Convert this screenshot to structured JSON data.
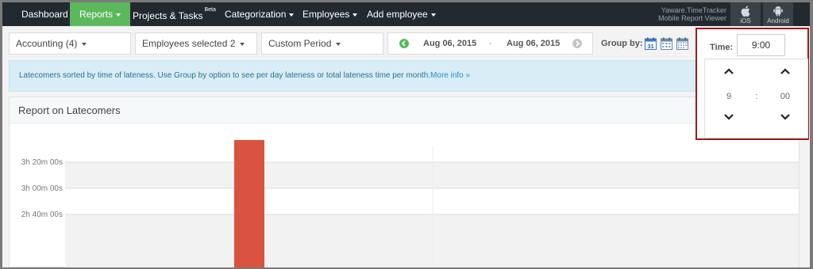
{
  "navbar": {
    "items": [
      {
        "label": "Dashboard",
        "dropdown": false
      },
      {
        "label": "Reports",
        "dropdown": true,
        "active": true
      },
      {
        "label": "Projects & Tasks",
        "badge": "Beta",
        "dropdown": false
      },
      {
        "label": "Categorization",
        "dropdown": true
      },
      {
        "label": "Employees",
        "dropdown": true
      },
      {
        "label": "Add employee",
        "dropdown": true
      }
    ],
    "mobile_line1": "Yaware.TimeTracker",
    "mobile_line2": "Mobile Report Viewer",
    "ios_label": "iOS",
    "android_label": "Android",
    "colors": {
      "bar": "#222a30",
      "active": "#5cb85c"
    }
  },
  "filters": {
    "department": "Accounting (4)",
    "employees": "Employees selected 2",
    "period": "Custom Period",
    "date_from": "Aug 06, 2015",
    "date_sep": "-",
    "date_to": "Aug 06, 2015",
    "group_by_label": "Group by:",
    "calendar_day": "31"
  },
  "info": {
    "text": "Latecomers sorted by time of lateness. Use Group by option to see per day lateness or total lateness time per month.",
    "link": "More info »"
  },
  "report": {
    "title": "Report on Latecomers"
  },
  "time_picker": {
    "label": "Time:",
    "value": "9:00",
    "hours": "9",
    "separator": ":",
    "minutes": "00"
  },
  "chart_data": {
    "type": "bar",
    "categories": [
      ""
    ],
    "values": [
      13020
    ],
    "y_tick_labels": [
      "3h 20m 00s",
      "3h 00m 00s",
      "2h 40m 00s"
    ],
    "y_tick_values": [
      12000,
      10800,
      9600
    ],
    "ylim": [
      9000,
      13500
    ],
    "bar_color": "#d9533f",
    "grid": true
  }
}
